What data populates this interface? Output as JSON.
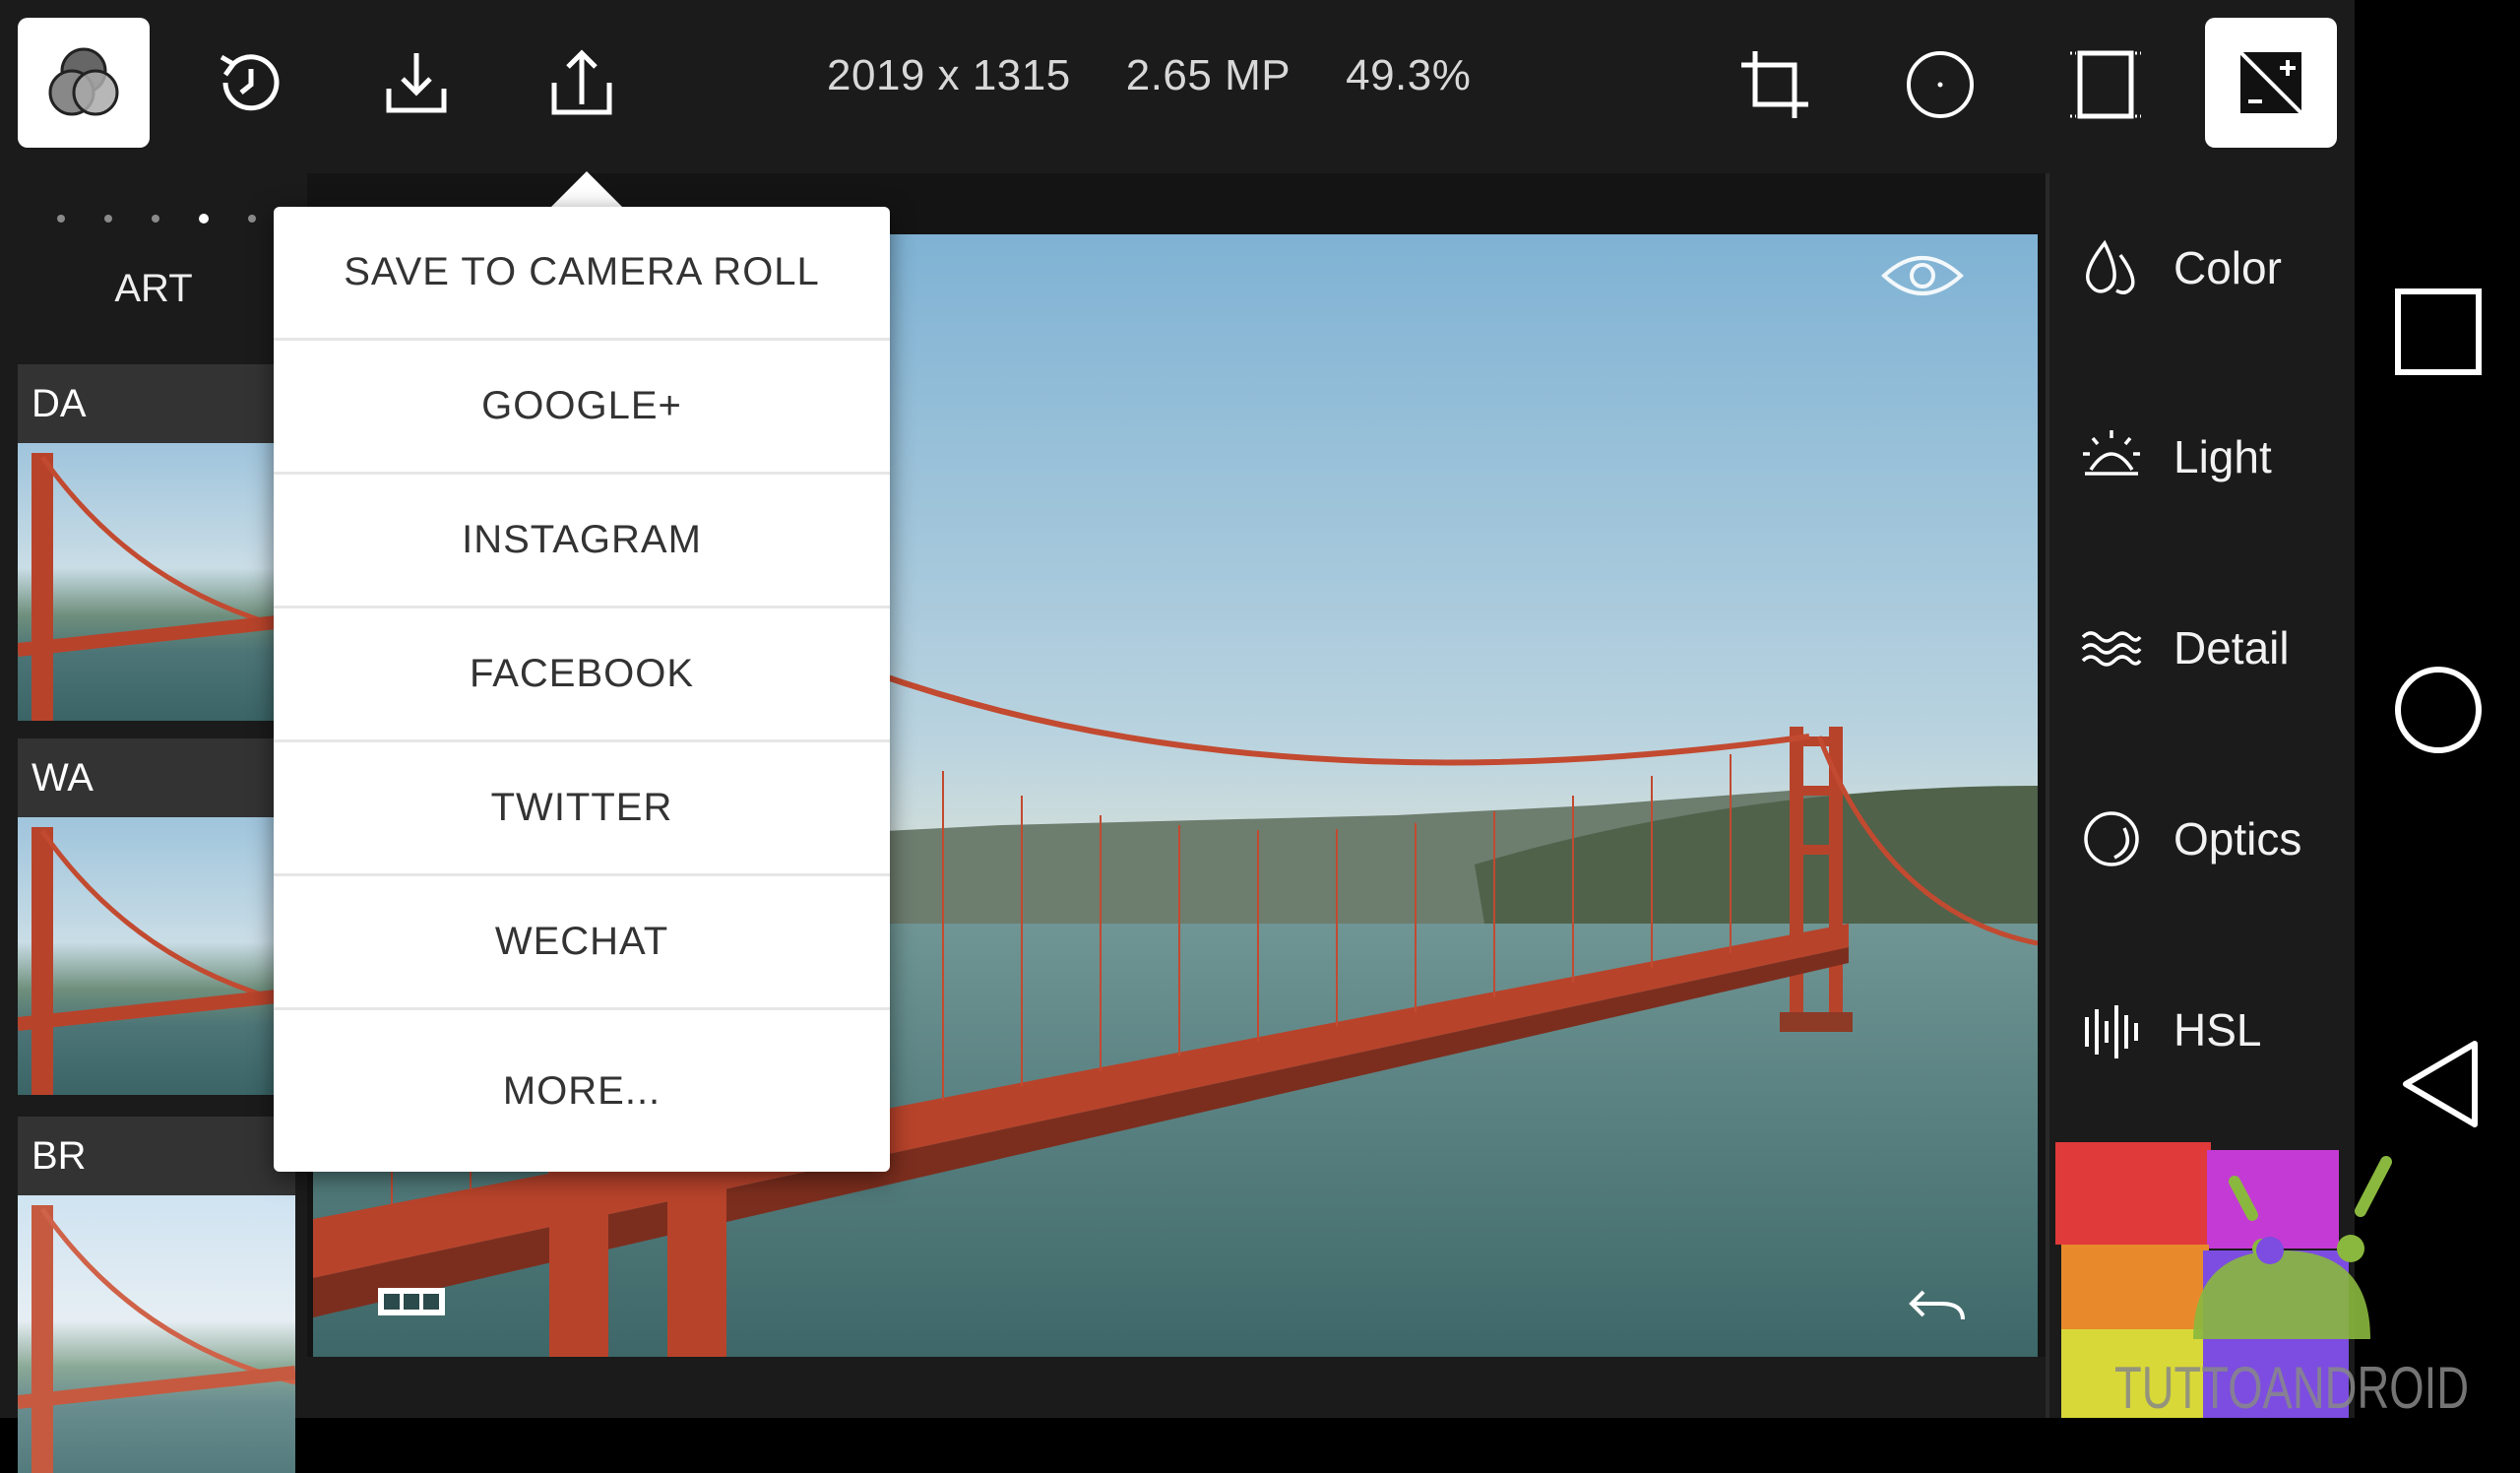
{
  "toolbar": {
    "info": {
      "dimensions": "2019 x 1315",
      "megapixels": "2.65 MP",
      "zoom": "49.3%"
    },
    "icons": [
      "presets-icon",
      "history-icon",
      "save-icon",
      "share-icon",
      "crop-icon",
      "vignette-icon",
      "frame-icon",
      "compare-icon"
    ]
  },
  "left_panel": {
    "category": "ART",
    "presets": [
      {
        "label": "DA"
      },
      {
        "label": "WA"
      },
      {
        "label": "BR"
      }
    ]
  },
  "share_menu": {
    "items": [
      "SAVE TO CAMERA ROLL",
      "GOOGLE+",
      "INSTAGRAM",
      "FACEBOOK",
      "TWITTER",
      "WECHAT",
      "MORE..."
    ]
  },
  "right_panel": {
    "tools": [
      "Color",
      "Light",
      "Detail",
      "Optics",
      "HSL"
    ]
  },
  "watermark": {
    "text": "TUTTOANDROID"
  },
  "colors": {
    "accent": "#ffffff",
    "panel": "#1b1b1b",
    "bridge": "#c0462c",
    "menu_text": "#333333"
  }
}
